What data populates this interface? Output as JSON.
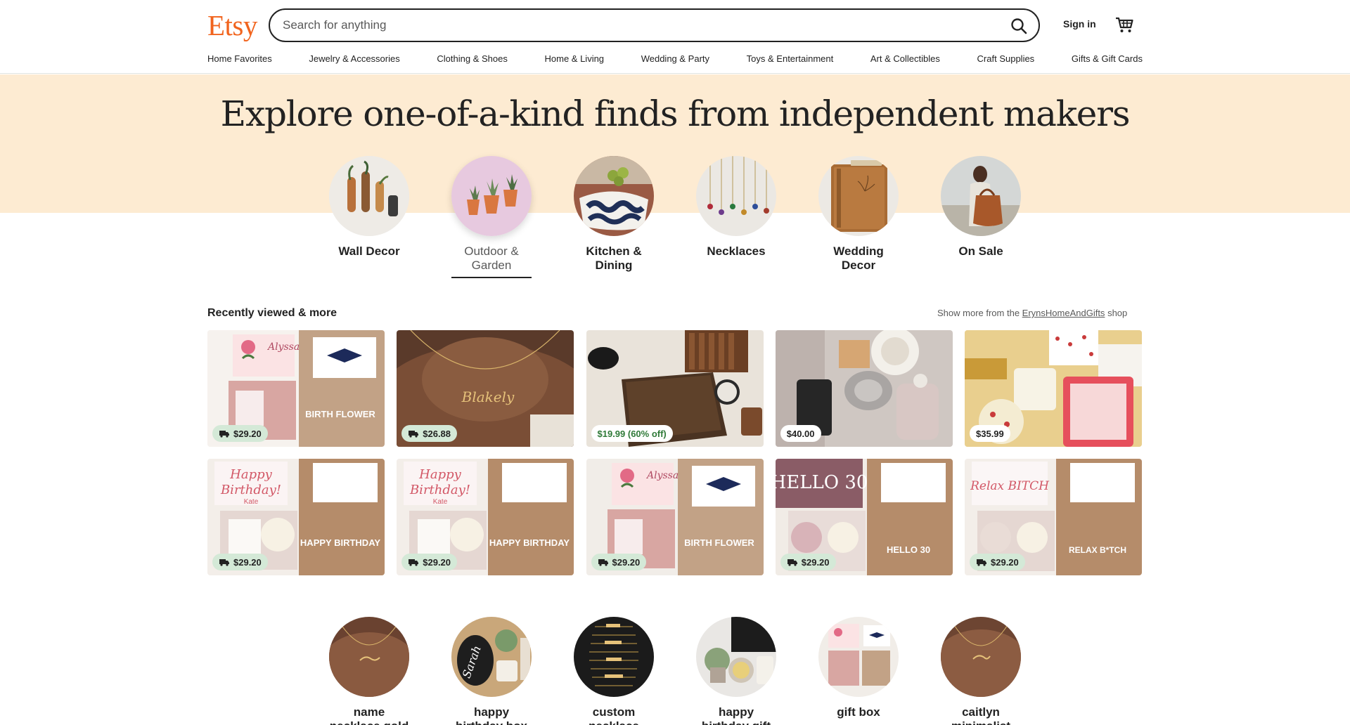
{
  "header": {
    "logo": "Etsy",
    "search_placeholder": "Search for anything",
    "signin": "Sign in"
  },
  "nav": [
    "Home Favorites",
    "Jewelry & Accessories",
    "Clothing & Shoes",
    "Home & Living",
    "Wedding & Party",
    "Toys & Entertainment",
    "Art & Collectibles",
    "Craft Supplies",
    "Gifts & Gift Cards"
  ],
  "hero": {
    "title": "Explore one-of-a-kind finds from independent makers",
    "categories": [
      {
        "label_line1": "Wall Decor",
        "label_line2": ""
      },
      {
        "label_line1": "Outdoor &",
        "label_line2": "Garden"
      },
      {
        "label_line1": "Kitchen &",
        "label_line2": "Dining"
      },
      {
        "label_line1": "Necklaces",
        "label_line2": ""
      },
      {
        "label_line1": "Wedding",
        "label_line2": "Decor"
      },
      {
        "label_line1": "On Sale",
        "label_line2": ""
      }
    ],
    "active_category": "Outdoor & Garden"
  },
  "recent": {
    "title": "Recently viewed & more",
    "more_prefix": "Show more from the",
    "shop_name": "ErynsHomeAndGifts",
    "more_suffix": "shop",
    "items": [
      {
        "price": "$29.20",
        "free_shipping": true,
        "card_text": "BIRTH FLOWER",
        "card_name": "Alyssa"
      },
      {
        "price": "$26.88",
        "free_shipping": true,
        "card_text": "",
        "card_name": "Blakely"
      },
      {
        "price": "$19.99 (60% off)",
        "free_shipping": false,
        "card_text": "",
        "card_name": ""
      },
      {
        "price": "$40.00",
        "free_shipping": false,
        "card_text": "",
        "card_name": ""
      },
      {
        "price": "$35.99",
        "free_shipping": false,
        "card_text": "",
        "card_name": ""
      },
      {
        "price": "$29.20",
        "free_shipping": true,
        "card_text": "HAPPY BIRTHDAY",
        "card_name": "Kate"
      },
      {
        "price": "$29.20",
        "free_shipping": true,
        "card_text": "HAPPY BIRTHDAY",
        "card_name": "Kate"
      },
      {
        "price": "$29.20",
        "free_shipping": true,
        "card_text": "BIRTH FLOWER",
        "card_name": "Alyssa"
      },
      {
        "price": "$29.20",
        "free_shipping": true,
        "card_text": "HELLO 30",
        "card_name": "HELLO 30"
      },
      {
        "price": "$29.20",
        "free_shipping": true,
        "card_text": "RELAX B*TCH",
        "card_name": "Relax BITCH"
      }
    ]
  },
  "searches": [
    {
      "line1": "name",
      "line2": "necklace gold"
    },
    {
      "line1": "happy",
      "line2": "birthday box"
    },
    {
      "line1": "custom",
      "line2": "necklace"
    },
    {
      "line1": "happy",
      "line2": "birthday gift"
    },
    {
      "line1": "gift box",
      "line2": ""
    },
    {
      "line1": "caitlyn",
      "line2": "minimalist"
    }
  ],
  "colors": {
    "brand": "#f1641e",
    "hero_band": "#fdebd2",
    "ship_tag": "#d4e9d7",
    "sale_text": "#2f7a38"
  }
}
